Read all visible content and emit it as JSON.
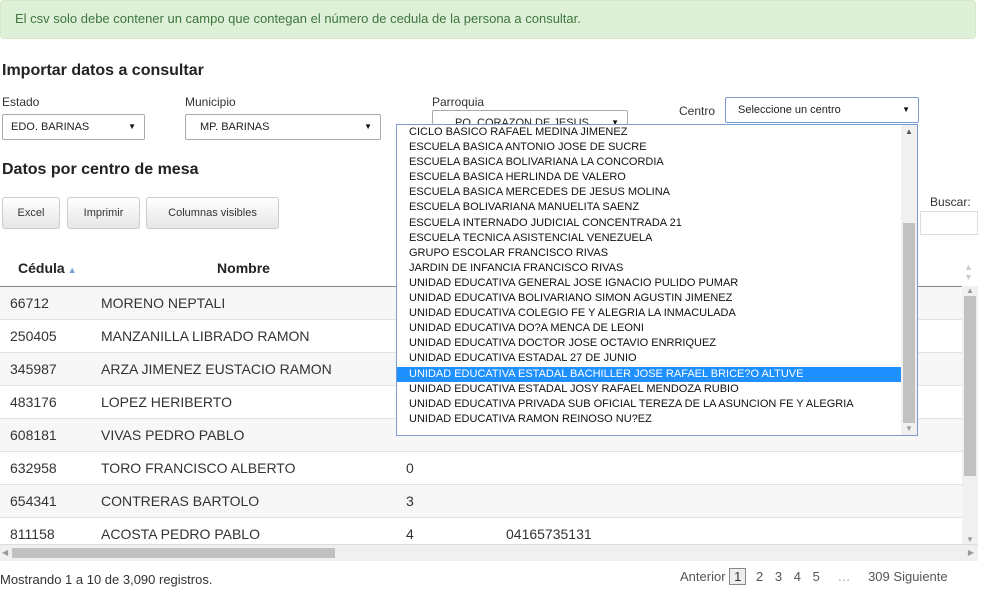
{
  "alert": "El csv solo debe contener un campo que contegan el número de cedula de la persona a consultar.",
  "import_title": "Importar datos a consultar",
  "filters": {
    "estado": {
      "label": "Estado",
      "value": "EDO. BARINAS"
    },
    "municipio": {
      "label": "Municipio",
      "value": "MP. BARINAS"
    },
    "parroquia": {
      "label": "Parroquia",
      "value": "PQ. CORAZON DE JESUS"
    },
    "centro": {
      "label": "Centro",
      "value": "Seleccione un centro"
    }
  },
  "section_title": "Datos por centro de mesa",
  "buttons": {
    "excel": "Excel",
    "print": "Imprimir",
    "columns": "Columnas visibles"
  },
  "search_label": "Buscar:",
  "table": {
    "headers": [
      "Cédula",
      "Nombre"
    ],
    "rows": [
      {
        "cedula": "66712",
        "nombre": "MORENO NEPTALI",
        "c3": "",
        "c4": ""
      },
      {
        "cedula": "250405",
        "nombre": "MANZANILLA LIBRADO RAMON",
        "c3": "",
        "c4": ""
      },
      {
        "cedula": "345987",
        "nombre": "ARZA JIMENEZ EUSTACIO RAMON",
        "c3": "",
        "c4": ""
      },
      {
        "cedula": "483176",
        "nombre": "LOPEZ HERIBERTO",
        "c3": "",
        "c4": ""
      },
      {
        "cedula": "608181",
        "nombre": "VIVAS PEDRO PABLO",
        "c3": "",
        "c4": ""
      },
      {
        "cedula": "632958",
        "nombre": "TORO FRANCISCO ALBERTO",
        "c3": "0",
        "c4": ""
      },
      {
        "cedula": "654341",
        "nombre": "CONTRERAS BARTOLO",
        "c3": "3",
        "c4": ""
      },
      {
        "cedula": "811158",
        "nombre": "ACOSTA PEDRO PABLO",
        "c3": "4",
        "c4": "04165735131"
      }
    ]
  },
  "info": "Mostrando 1 a 10 de 3,090 registros.",
  "pagination": {
    "prev": "Anterior",
    "current": "1",
    "pages": [
      "2",
      "3",
      "4",
      "5"
    ],
    "ellipsis": "…",
    "last": "309",
    "next": "Siguiente"
  },
  "centro_options": [
    "CICLO BASICO RAFAEL MEDINA JIMENEZ",
    "ESCUELA BASICA ANTONIO JOSE DE SUCRE",
    "ESCUELA BASICA BOLIVARIANA LA CONCORDIA",
    "ESCUELA BASICA HERLINDA DE VALERO",
    "ESCUELA BASICA MERCEDES DE JESUS MOLINA",
    "ESCUELA BOLIVARIANA MANUELITA SAENZ",
    "ESCUELA INTERNADO JUDICIAL CONCENTRADA 21",
    "ESCUELA TECNICA ASISTENCIAL VENEZUELA",
    "GRUPO ESCOLAR FRANCISCO RIVAS",
    "JARDIN DE INFANCIA FRANCISCO RIVAS",
    "UNIDAD EDUCATIVA GENERAL JOSE IGNACIO PULIDO PUMAR",
    "UNIDAD EDUCATIVA BOLIVARIANO SIMON AGUSTIN JIMENEZ",
    "UNIDAD EDUCATIVA COLEGIO FE Y ALEGRIA LA INMACULADA",
    "UNIDAD EDUCATIVA DO?A MENCA DE LEONI",
    "UNIDAD EDUCATIVA DOCTOR JOSE OCTAVIO ENRRIQUEZ",
    "UNIDAD EDUCATIVA ESTADAL 27 DE JUNIO",
    "UNIDAD EDUCATIVA ESTADAL BACHILLER JOSE RAFAEL BRICE?O ALTUVE",
    "UNIDAD EDUCATIVA ESTADAL JOSY RAFAEL MENDOZA RUBIO",
    "UNIDAD EDUCATIVA PRIVADA SUB OFICIAL TEREZA DE LA ASUNCION FE Y ALEGRIA",
    "UNIDAD EDUCATIVA RAMON REINOSO NU?EZ"
  ],
  "highlighted_option": "UNIDAD EDUCATIVA ESTADAL BACHILLER JOSE RAFAEL BRICE?O ALTUVE"
}
